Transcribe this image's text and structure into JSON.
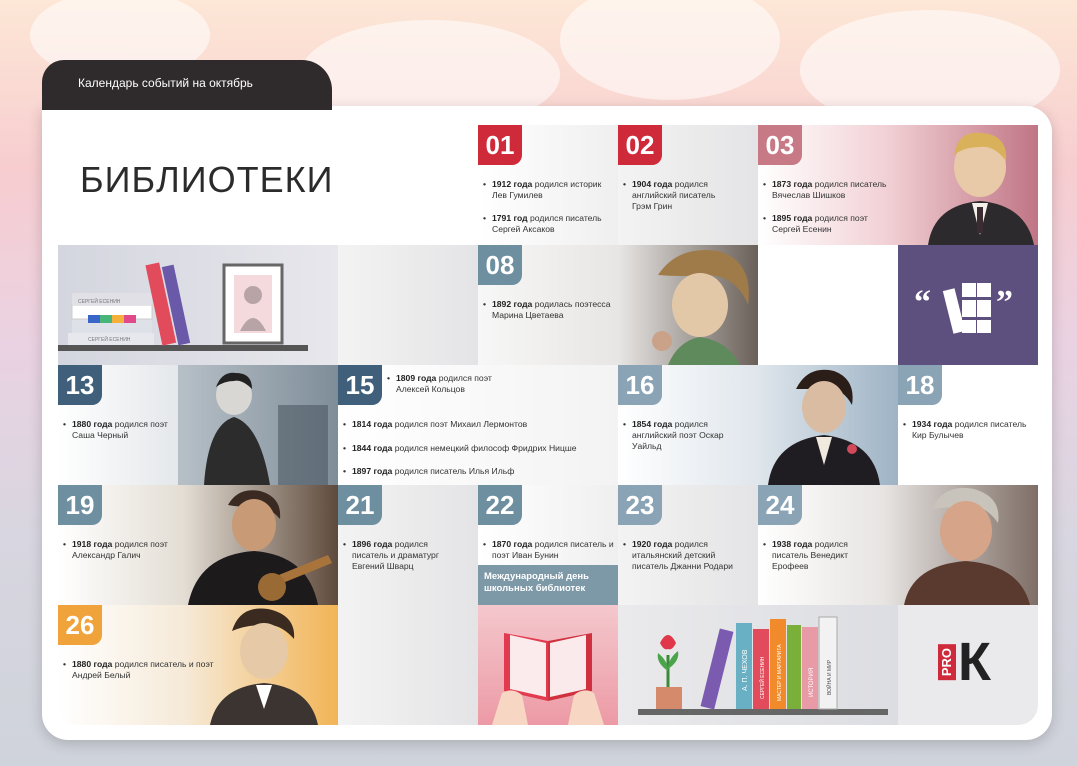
{
  "header": {
    "tab_label": "Календарь событий на октябрь",
    "title": "БИБЛИОТЕКИ"
  },
  "days": [
    {
      "num": "01",
      "events": [
        {
          "bold": "1912 года",
          "text": "родился историк Лев Гумилев"
        },
        {
          "bold": "1791 год",
          "text": "родился писатель Сергей Аксаков"
        }
      ]
    },
    {
      "num": "02",
      "events": [
        {
          "bold": "1904 года",
          "text": "родился английский писатель Грэм Грин"
        }
      ]
    },
    {
      "num": "03",
      "events": [
        {
          "bold": "1873 года",
          "text": "родился писатель Вячеслав Шишков"
        },
        {
          "bold": "1895 года",
          "text": "родился поэт Сергей Есенин"
        }
      ]
    },
    {
      "num": "08",
      "events": [
        {
          "bold": "1892 года",
          "text": "родилась поэтесса Марина Цветаева"
        }
      ]
    },
    {
      "num": "13",
      "events": [
        {
          "bold": "1880 года",
          "text": "родился поэт Саша Черный"
        }
      ]
    },
    {
      "num": "15",
      "events": [
        {
          "bold": "1809 года",
          "text": "родился поэт Алексей Кольцов"
        },
        {
          "bold": "1814 года",
          "text": "родился поэт Михаил Лермонтов"
        },
        {
          "bold": "1844 года",
          "text": "родился немецкий философ Фридрих Ницше"
        },
        {
          "bold": "1897 года",
          "text": "родился писатель Илья Ильф"
        }
      ]
    },
    {
      "num": "16",
      "events": [
        {
          "bold": "1854 года",
          "text": "родился английский поэт Оскар Уайльд"
        }
      ]
    },
    {
      "num": "18",
      "events": [
        {
          "bold": "1934 года",
          "text": "родился писатель Кир Булычев"
        }
      ]
    },
    {
      "num": "19",
      "events": [
        {
          "bold": "1918 года",
          "text": "родился поэт Александр Галич"
        }
      ]
    },
    {
      "num": "21",
      "events": [
        {
          "bold": "1896 года",
          "text": "родился писатель и драматург Евгений Шварц"
        }
      ]
    },
    {
      "num": "22",
      "events": [
        {
          "bold": "1870 года",
          "text": "родился писатель и поэт Иван Бунин"
        }
      ],
      "banner": "Международный день школьных библиотек"
    },
    {
      "num": "23",
      "events": [
        {
          "bold": "1920 года",
          "text": "родился итальянский детский писатель Джанни Родари"
        }
      ]
    },
    {
      "num": "24",
      "events": [
        {
          "bold": "1938 года",
          "text": "родился писатель Венедикт Ерофеев"
        }
      ]
    },
    {
      "num": "26",
      "events": [
        {
          "bold": "1880 года",
          "text": "родился писатель и поэт Андрей Белый"
        }
      ]
    }
  ],
  "books": {
    "shelf1": [
      "СЕРГЕЙ ЕСЕНИН",
      "СЕРГЕЙ ЕСЕНИН"
    ],
    "shelf2": [
      "А. П. ЧЕХОВ",
      "СЕРГЕЙ ЕСЕНИН",
      "МАСТЕР И МАРГАРИТА",
      "ИСТОРИЯ",
      "ВОЙНА И МИР"
    ]
  },
  "logo": {
    "pro": "PRO",
    "k": "К"
  },
  "colors": {
    "red": "#cf2a3a",
    "blue": "#3f5f7a",
    "teal": "#6e8fa0",
    "orange": "#f0a33a",
    "purple": "#5d4f7e",
    "dark_tab": "#2f2a2b"
  }
}
